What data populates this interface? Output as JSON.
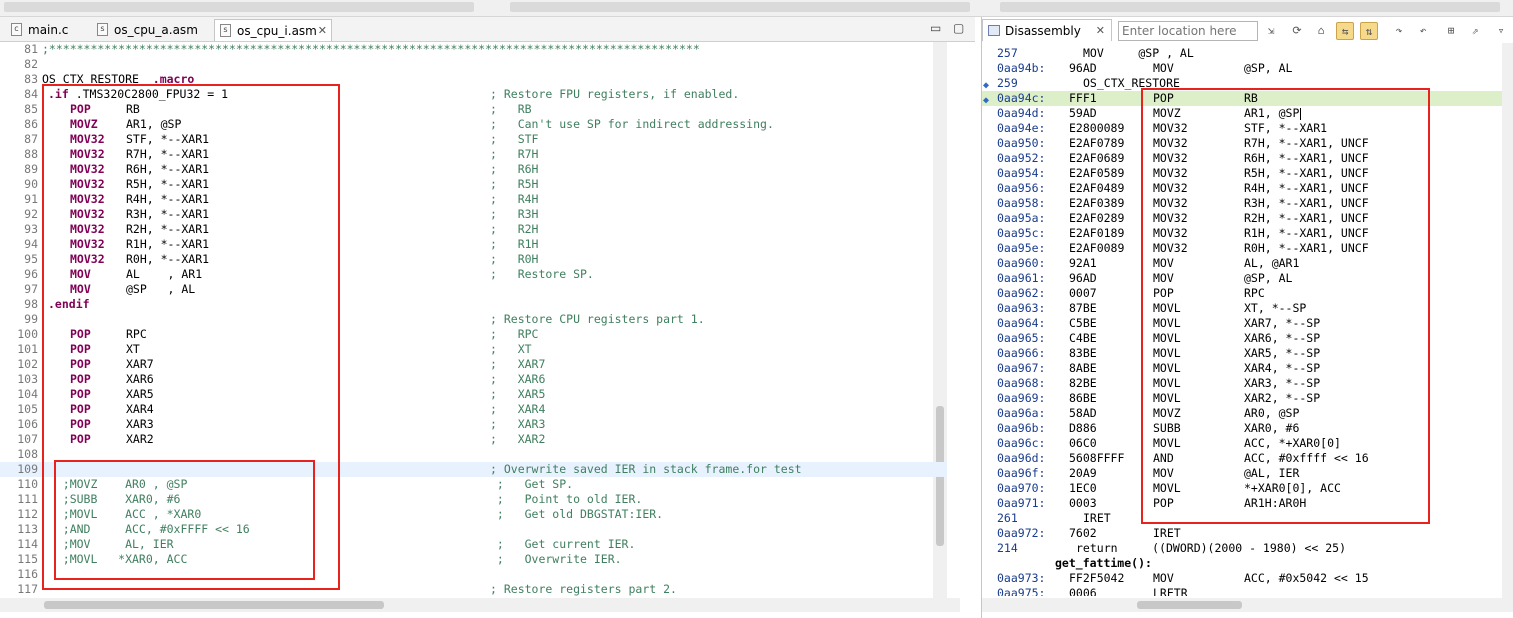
{
  "editor": {
    "tabs": [
      {
        "label": "main.c",
        "icon": "c-file-icon"
      },
      {
        "label": "os_cpu_a.asm",
        "icon": "asm-file-icon"
      },
      {
        "label": "os_cpu_i.asm",
        "icon": "asm-file-icon",
        "active": true
      }
    ],
    "lines": [
      {
        "n": "81",
        "code": ";**********************************************************************************************",
        "cls": "green"
      },
      {
        "n": "82",
        "code": ""
      },
      {
        "n": "83",
        "code": "OS_CTX_RESTORE  .macro",
        "kwpart": ".macro"
      },
      {
        "n": "84",
        "code": ".if .TMS320C2800_FPU32 = 1",
        "comment": "; Restore FPU registers, if enabled."
      },
      {
        "n": "85",
        "mn": "POP",
        "args": "RB",
        "comment": ";   RB"
      },
      {
        "n": "86",
        "mn": "MOVZ",
        "args": "AR1, @SP",
        "comment": ";   Can't use SP for indirect addressing."
      },
      {
        "n": "87",
        "mn": "MOV32",
        "args": "STF, *--XAR1",
        "comment": ";   STF"
      },
      {
        "n": "88",
        "mn": "MOV32",
        "args": "R7H, *--XAR1",
        "comment": ";   R7H"
      },
      {
        "n": "89",
        "mn": "MOV32",
        "args": "R6H, *--XAR1",
        "comment": ";   R6H"
      },
      {
        "n": "90",
        "mn": "MOV32",
        "args": "R5H, *--XAR1",
        "comment": ";   R5H"
      },
      {
        "n": "91",
        "mn": "MOV32",
        "args": "R4H, *--XAR1",
        "comment": ";   R4H"
      },
      {
        "n": "92",
        "mn": "MOV32",
        "args": "R3H, *--XAR1",
        "comment": ";   R3H"
      },
      {
        "n": "93",
        "mn": "MOV32",
        "args": "R2H, *--XAR1",
        "comment": ";   R2H"
      },
      {
        "n": "94",
        "mn": "MOV32",
        "args": "R1H, *--XAR1",
        "comment": ";   R1H"
      },
      {
        "n": "95",
        "mn": "MOV32",
        "args": "R0H, *--XAR1",
        "comment": ";   R0H"
      },
      {
        "n": "96",
        "mn": "MOV",
        "args": "AL    , AR1",
        "comment": ";   Restore SP."
      },
      {
        "n": "97",
        "mn": "MOV",
        "args": "@SP   , AL",
        "comment": ""
      },
      {
        "n": "98",
        "code": ".endif",
        "kw": true
      },
      {
        "n": "99",
        "code": "",
        "comment": "; Restore CPU registers part 1."
      },
      {
        "n": "100",
        "mn": "POP",
        "args": "RPC",
        "comment": ";   RPC"
      },
      {
        "n": "101",
        "mn": "POP",
        "args": "XT",
        "comment": ";   XT"
      },
      {
        "n": "102",
        "mn": "POP",
        "args": "XAR7",
        "comment": ";   XAR7"
      },
      {
        "n": "103",
        "mn": "POP",
        "args": "XAR6",
        "comment": ";   XAR6"
      },
      {
        "n": "104",
        "mn": "POP",
        "args": "XAR5",
        "comment": ";   XAR5"
      },
      {
        "n": "105",
        "mn": "POP",
        "args": "XAR4",
        "comment": ";   XAR4"
      },
      {
        "n": "106",
        "mn": "POP",
        "args": "XAR3",
        "comment": ";   XAR3"
      },
      {
        "n": "107",
        "mn": "POP",
        "args": "XAR2",
        "comment": ";   XAR2"
      },
      {
        "n": "108",
        "code": ""
      },
      {
        "n": "109",
        "code": "",
        "comment": "; Overwrite saved IER in stack frame.for test",
        "hl": true
      },
      {
        "n": "110",
        "code": "   ;MOVZ    AR0 , @SP",
        "cls": "green",
        "comment": " ;   Get SP."
      },
      {
        "n": "111",
        "code": "   ;SUBB    XAR0, #6",
        "cls": "green",
        "comment": " ;   Point to old IER."
      },
      {
        "n": "112",
        "code": "   ;MOVL    ACC , *XAR0",
        "cls": "green",
        "comment": " ;   Get old DBGSTAT:IER."
      },
      {
        "n": "113",
        "code": "   ;AND     ACC, #0xFFFF << 16",
        "cls": "green",
        "comment": ""
      },
      {
        "n": "114",
        "code": "   ;MOV     AL, IER",
        "cls": "green",
        "comment": " ;   Get current IER."
      },
      {
        "n": "115",
        "code": "   ;MOVL   *XAR0, ACC",
        "cls": "green",
        "comment": " ;   Overwrite IER."
      },
      {
        "n": "116",
        "code": ""
      },
      {
        "n": "117",
        "code": "",
        "comment": "; Restore registers part 2."
      }
    ]
  },
  "disassembly": {
    "tab_label": "Disassembly",
    "location_placeholder": "Enter location here",
    "lines": [
      {
        "type": "src",
        "num": "257",
        "text": "MOV     @SP , AL"
      },
      {
        "addr": "0aa94b:",
        "op": "96AD",
        "mn": "MOV",
        "args": "@SP, AL"
      },
      {
        "type": "src",
        "num": "259",
        "text": "OS_CTX_RESTORE",
        "marker": true
      },
      {
        "addr": "0aa94c:",
        "op": "FFF1",
        "mn": "POP",
        "args": "RB",
        "current": true,
        "marker": true
      },
      {
        "addr": "0aa94d:",
        "op": "59AD",
        "mn": "MOVZ",
        "args": "AR1, @SP",
        "caret": true
      },
      {
        "addr": "0aa94e:",
        "op": "E2800089",
        "mn": "MOV32",
        "args": "STF, *--XAR1"
      },
      {
        "addr": "0aa950:",
        "op": "E2AF0789",
        "mn": "MOV32",
        "args": "R7H, *--XAR1, UNCF"
      },
      {
        "addr": "0aa952:",
        "op": "E2AF0689",
        "mn": "MOV32",
        "args": "R6H, *--XAR1, UNCF"
      },
      {
        "addr": "0aa954:",
        "op": "E2AF0589",
        "mn": "MOV32",
        "args": "R5H, *--XAR1, UNCF"
      },
      {
        "addr": "0aa956:",
        "op": "E2AF0489",
        "mn": "MOV32",
        "args": "R4H, *--XAR1, UNCF"
      },
      {
        "addr": "0aa958:",
        "op": "E2AF0389",
        "mn": "MOV32",
        "args": "R3H, *--XAR1, UNCF"
      },
      {
        "addr": "0aa95a:",
        "op": "E2AF0289",
        "mn": "MOV32",
        "args": "R2H, *--XAR1, UNCF"
      },
      {
        "addr": "0aa95c:",
        "op": "E2AF0189",
        "mn": "MOV32",
        "args": "R1H, *--XAR1, UNCF"
      },
      {
        "addr": "0aa95e:",
        "op": "E2AF0089",
        "mn": "MOV32",
        "args": "R0H, *--XAR1, UNCF"
      },
      {
        "addr": "0aa960:",
        "op": "92A1",
        "mn": "MOV",
        "args": "AL, @AR1"
      },
      {
        "addr": "0aa961:",
        "op": "96AD",
        "mn": "MOV",
        "args": "@SP, AL"
      },
      {
        "addr": "0aa962:",
        "op": "0007",
        "mn": "POP",
        "args": "RPC"
      },
      {
        "addr": "0aa963:",
        "op": "87BE",
        "mn": "MOVL",
        "args": "XT, *--SP"
      },
      {
        "addr": "0aa964:",
        "op": "C5BE",
        "mn": "MOVL",
        "args": "XAR7, *--SP"
      },
      {
        "addr": "0aa965:",
        "op": "C4BE",
        "mn": "MOVL",
        "args": "XAR6, *--SP"
      },
      {
        "addr": "0aa966:",
        "op": "83BE",
        "mn": "MOVL",
        "args": "XAR5, *--SP"
      },
      {
        "addr": "0aa967:",
        "op": "8ABE",
        "mn": "MOVL",
        "args": "XAR4, *--SP"
      },
      {
        "addr": "0aa968:",
        "op": "82BE",
        "mn": "MOVL",
        "args": "XAR3, *--SP"
      },
      {
        "addr": "0aa969:",
        "op": "86BE",
        "mn": "MOVL",
        "args": "XAR2, *--SP"
      },
      {
        "addr": "0aa96a:",
        "op": "58AD",
        "mn": "MOVZ",
        "args": "AR0, @SP"
      },
      {
        "addr": "0aa96b:",
        "op": "D886",
        "mn": "SUBB",
        "args": "XAR0, #6"
      },
      {
        "addr": "0aa96c:",
        "op": "06C0",
        "mn": "MOVL",
        "args": "ACC, *+XAR0[0]"
      },
      {
        "addr": "0aa96d:",
        "op": "5608FFFF",
        "mn": "AND",
        "args": "ACC, #0xffff << 16"
      },
      {
        "addr": "0aa96f:",
        "op": "20A9",
        "mn": "MOV",
        "args": "@AL, IER"
      },
      {
        "addr": "0aa970:",
        "op": "1EC0",
        "mn": "MOVL",
        "args": "*+XAR0[0], ACC"
      },
      {
        "addr": "0aa971:",
        "op": "0003",
        "mn": "POP",
        "args": "AR1H:AR0H"
      },
      {
        "type": "src",
        "num": "261",
        "text": "IRET"
      },
      {
        "addr": "0aa972:",
        "op": "7602",
        "mn": "IRET",
        "args": ""
      },
      {
        "type": "src",
        "num": "214",
        "text": "return     ((DWORD)(2000 - 1980) << 25)",
        "bold": true
      },
      {
        "type": "fn",
        "text": "get_fattime():"
      },
      {
        "addr": "0aa973:",
        "op": "FF2F5042",
        "mn": "MOV",
        "args": "ACC, #0x5042 << 15"
      },
      {
        "addr": "0aa975:",
        "op": "0006",
        "mn": "LRETR",
        "args": ""
      }
    ]
  },
  "annotation_color": "#e8221c"
}
